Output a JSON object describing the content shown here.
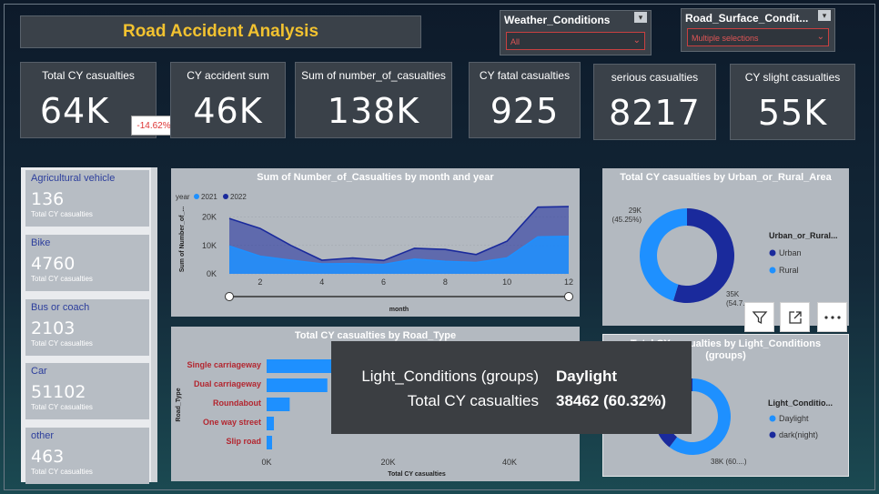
{
  "title": "Road Accident Analysis",
  "slicers": {
    "weather": {
      "label": "Weather_Conditions",
      "value": "All"
    },
    "road_surface": {
      "label": "Road_Surface_Condit...",
      "value": "Multiple selections"
    }
  },
  "kpis": [
    {
      "label": "Total CY casualties",
      "value": "64K",
      "delta": "-14.62%"
    },
    {
      "label": "CY accident sum",
      "value": "46K"
    },
    {
      "label": "Sum of number_of_casualties",
      "value": "138K"
    },
    {
      "label": "CY fatal casualties",
      "value": "925"
    },
    {
      "label": "serious casualties",
      "value": "8217"
    },
    {
      "label": "CY slight casualties",
      "value": "55K"
    }
  ],
  "vehicles": {
    "sub_label": "Total CY casualties",
    "items": [
      {
        "category": "Agricultural vehicle",
        "value": "136"
      },
      {
        "category": "Bike",
        "value": "4760"
      },
      {
        "category": "Bus or coach",
        "value": "2103"
      },
      {
        "category": "Car",
        "value": "51102"
      },
      {
        "category": "other",
        "value": "463"
      }
    ]
  },
  "panels": {
    "line_title": "Sum of Number_of_Casualties by month and year",
    "road_title": "Total CY casualties by Road_Type",
    "urban_title": "Total CY casualties by Urban_or_Rural_Area",
    "light_title_1": "Total CY casualties by Light_Conditions",
    "light_title_2": "(groups)"
  },
  "colors": {
    "cy2021": "#1e90ff",
    "cy2022": "#1a2a9c",
    "accent": "#f2c230"
  },
  "chart_data": [
    {
      "type": "area",
      "title": "Sum of Number_of_Casualties by month and year",
      "xlabel": "month",
      "ylabel": "Sum of Number_of_...",
      "legend_title": "year",
      "x": [
        1,
        2,
        3,
        4,
        5,
        6,
        7,
        8,
        9,
        10,
        11,
        12
      ],
      "x_ticks": [
        "2",
        "4",
        "6",
        "8",
        "10",
        "12"
      ],
      "y_ticks": [
        "0K",
        "10K",
        "20K"
      ],
      "ylim": [
        0,
        25000
      ],
      "series": [
        {
          "name": "2021",
          "values": [
            9800,
            6200,
            4800,
            3500,
            3600,
            3300,
            5200,
            4400,
            4000,
            5600,
            13000,
            13200
          ]
        },
        {
          "name": "2022",
          "values": [
            19500,
            16000,
            10000,
            4800,
            5600,
            4700,
            9000,
            8600,
            6800,
            11500,
            23500,
            23700
          ]
        }
      ]
    },
    {
      "type": "bar",
      "title": "Total CY casualties by Road_Type",
      "xlabel": "Total CY casualties",
      "ylabel": "Road_Type",
      "categories": [
        "Single carriageway",
        "Dual carriageway",
        "Roundabout",
        "One way street",
        "Slip road"
      ],
      "values": [
        48000,
        10000,
        3800,
        1200,
        900
      ],
      "x_ticks": [
        "0K",
        "20K",
        "40K"
      ],
      "xlim": [
        0,
        50000
      ]
    },
    {
      "type": "pie",
      "title": "Total CY casualties by Urban_or_Rural_Area",
      "legend_title": "Urban_or_Rural...",
      "categories": [
        "Urban",
        "Rural"
      ],
      "values": [
        35000,
        29000
      ],
      "labels": [
        "35K (54.7...",
        "29K (45.25%)"
      ]
    },
    {
      "type": "pie",
      "title": "Total CY casualties by Light_Conditions (groups)",
      "legend_title": "Light_Conditio...",
      "categories": [
        "Daylight",
        "dark(night)"
      ],
      "values": [
        38462,
        25300
      ],
      "labels": [
        "38K (60....)"
      ]
    }
  ],
  "tooltip": {
    "k1": "Light_Conditions (groups)",
    "v1": "Daylight",
    "k2": "Total CY casualties",
    "v2": "38462 (60.32%)"
  }
}
